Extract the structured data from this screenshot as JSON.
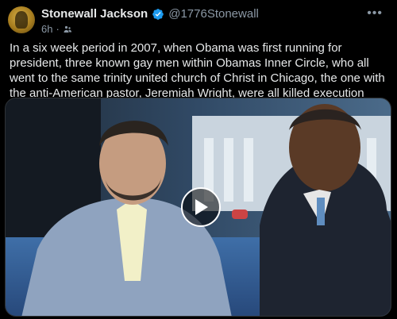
{
  "author": {
    "name": "Stonewall Jackson",
    "handle": "@1776Stonewall",
    "time": "6h",
    "time_separator": "·"
  },
  "post": {
    "text": "In a six week period in 2007, when Obama was first running for president, three known gay men within Obamas Inner Circle, who all went to the same trinity united church of Christ in Chicago, the one with the anti-American pastor, Jeremiah Wright, were all killed execution style, their murderers never Found"
  },
  "icons": {
    "verified": "verified-badge-icon",
    "menu": "more-options-icon",
    "audience": "audience-icon",
    "play": "play-icon"
  },
  "colors": {
    "verified_blue": "#1d9bf0",
    "secondary_text": "#8b98a5"
  }
}
